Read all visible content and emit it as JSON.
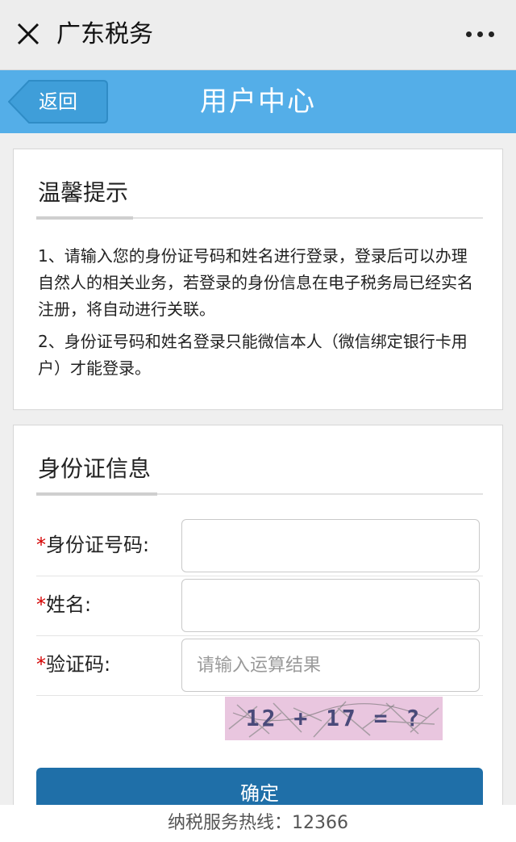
{
  "wechat_bar": {
    "title": "广东税务",
    "close_icon": "close-icon",
    "more_icon": "more-dots-icon"
  },
  "header": {
    "back_label": "返回",
    "title": "用户中心",
    "color": "#54aee8"
  },
  "tips_card": {
    "title": "温馨提示",
    "items": [
      "1、请输入您的身份证号码和姓名进行登录，登录后可以办理自然人的相关业务，若登录的身份信息在电子税务局已经实名注册，将自动进行关联。",
      "2、身份证号码和姓名登录只能微信本人（微信绑定银行卡用户）才能登录。"
    ]
  },
  "id_card": {
    "title": "身份证信息",
    "required_mark": "*",
    "fields": {
      "id_number": {
        "label": "身份证号码:",
        "value": "",
        "placeholder": ""
      },
      "name": {
        "label": "姓名:",
        "value": "",
        "placeholder": ""
      },
      "captcha": {
        "label": "验证码:",
        "value": "",
        "placeholder": "请输入运算结果"
      }
    },
    "captcha_image_text": "12 + 17 = ?",
    "confirm_label": "确定",
    "button_color": "#1f6fa8"
  },
  "footer": {
    "hotline": "纳税服务热线：12366"
  }
}
